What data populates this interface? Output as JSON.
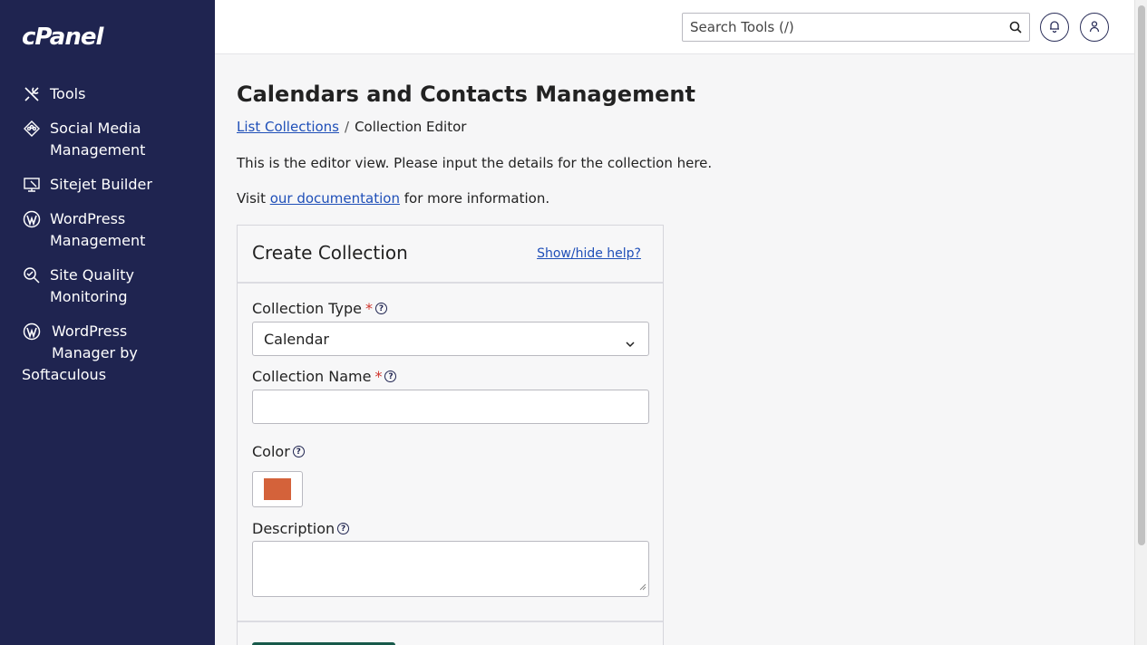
{
  "app": {
    "logo_text": "cPanel"
  },
  "sidebar": {
    "items": [
      {
        "icon": "tools-icon",
        "label": "Tools"
      },
      {
        "icon": "social-media-icon",
        "label": "Social Media\nManagement"
      },
      {
        "icon": "sitejet-icon",
        "label": "Sitejet Builder"
      },
      {
        "icon": "wordpress-icon",
        "label": "WordPress\nManagement"
      },
      {
        "icon": "site-quality-icon",
        "label": "Site Quality\nMonitoring"
      },
      {
        "icon": "wordpress-icon",
        "label_line1": "WordPress",
        "label_line2": "Manager by",
        "label_line3": "Softaculous"
      }
    ]
  },
  "header": {
    "search_placeholder": "Search Tools (/)"
  },
  "main": {
    "page_title": "Calendars and Contacts Management",
    "breadcrumb": {
      "link": "List Collections",
      "separator": "/",
      "current": "Collection Editor"
    },
    "description": "This is the editor view. Please input the details for the collection here.",
    "visit_prefix": "Visit ",
    "visit_link": "our documentation",
    "visit_suffix": " for more information."
  },
  "form": {
    "title": "Create Collection",
    "help_link": "Show/hide help?",
    "type_label": "Collection Type",
    "type_value": "Calendar",
    "name_label": "Collection Name",
    "name_value": "",
    "required_mark": "*",
    "color_label": "Color",
    "color_value": "#d4623a",
    "description_label": "Description",
    "description_value": ""
  }
}
